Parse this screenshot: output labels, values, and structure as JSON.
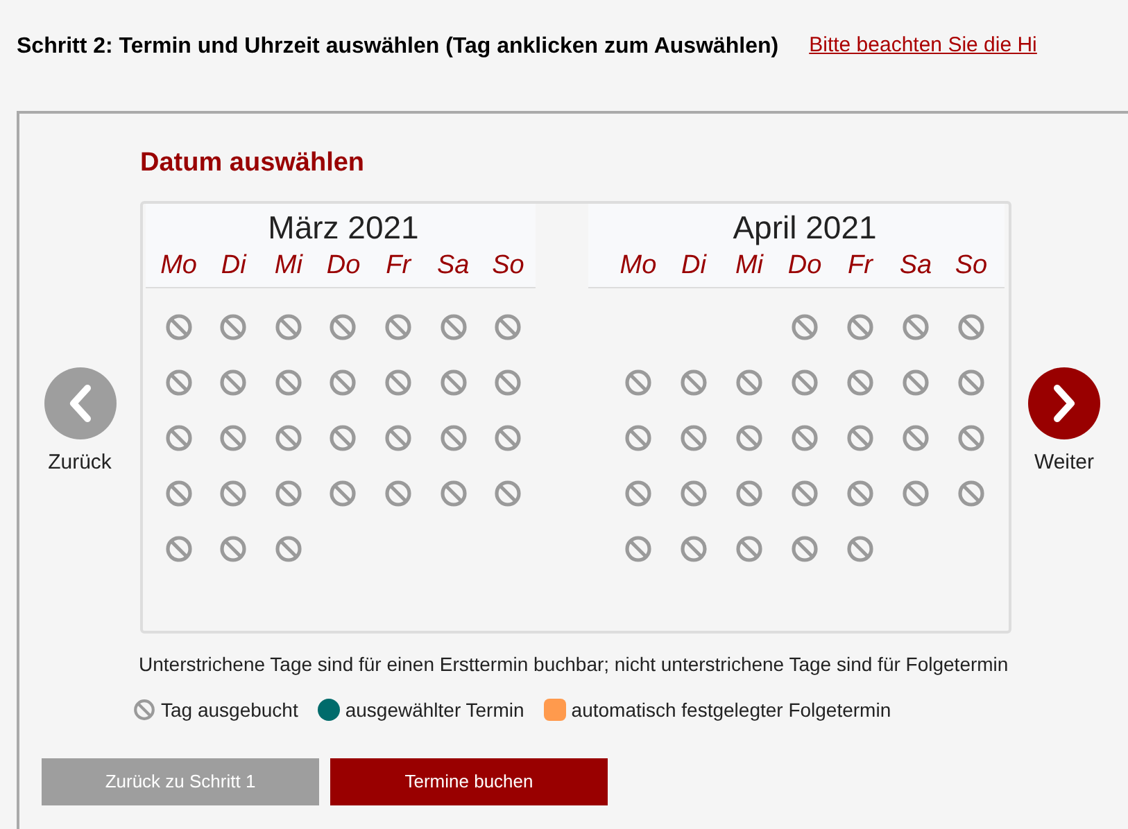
{
  "heading": "Schritt 2: Termin und Uhrzeit auswählen (Tag anklicken zum Auswählen)",
  "notice_link": "Bitte beachten Sie die Hi",
  "section_title": "Datum auswählen",
  "prev": {
    "label": "Zurück",
    "enabled": false
  },
  "next": {
    "label": "Weiter",
    "enabled": true
  },
  "months": [
    {
      "title": "März 2021",
      "weekdays": [
        "Mo",
        "Di",
        "Mi",
        "Do",
        "Fr",
        "Sa",
        "So"
      ],
      "days": [
        {
          "kind": "day",
          "booked": true
        },
        {
          "kind": "day",
          "booked": true
        },
        {
          "kind": "day",
          "booked": true
        },
        {
          "kind": "day",
          "booked": true
        },
        {
          "kind": "day",
          "booked": true
        },
        {
          "kind": "day",
          "booked": true
        },
        {
          "kind": "day",
          "booked": true
        },
        {
          "kind": "day",
          "booked": true
        },
        {
          "kind": "day",
          "booked": true
        },
        {
          "kind": "day",
          "booked": true
        },
        {
          "kind": "day",
          "booked": true
        },
        {
          "kind": "day",
          "booked": true
        },
        {
          "kind": "day",
          "booked": true
        },
        {
          "kind": "day",
          "booked": true
        },
        {
          "kind": "day",
          "booked": true
        },
        {
          "kind": "day",
          "booked": true
        },
        {
          "kind": "day",
          "booked": true
        },
        {
          "kind": "day",
          "booked": true
        },
        {
          "kind": "day",
          "booked": true
        },
        {
          "kind": "day",
          "booked": true
        },
        {
          "kind": "day",
          "booked": true
        },
        {
          "kind": "day",
          "booked": true
        },
        {
          "kind": "day",
          "booked": true
        },
        {
          "kind": "day",
          "booked": true
        },
        {
          "kind": "day",
          "booked": true
        },
        {
          "kind": "day",
          "booked": true
        },
        {
          "kind": "day",
          "booked": true
        },
        {
          "kind": "day",
          "booked": true
        },
        {
          "kind": "day",
          "booked": true
        },
        {
          "kind": "day",
          "booked": true
        },
        {
          "kind": "day",
          "booked": true
        }
      ]
    },
    {
      "title": "April 2021",
      "weekdays": [
        "Mo",
        "Di",
        "Mi",
        "Do",
        "Fr",
        "Sa",
        "So"
      ],
      "days": [
        {
          "kind": "blank"
        },
        {
          "kind": "blank"
        },
        {
          "kind": "blank"
        },
        {
          "kind": "day",
          "booked": true
        },
        {
          "kind": "day",
          "booked": true
        },
        {
          "kind": "day",
          "booked": true
        },
        {
          "kind": "day",
          "booked": true
        },
        {
          "kind": "day",
          "booked": true
        },
        {
          "kind": "day",
          "booked": true
        },
        {
          "kind": "day",
          "booked": true
        },
        {
          "kind": "day",
          "booked": true
        },
        {
          "kind": "day",
          "booked": true
        },
        {
          "kind": "day",
          "booked": true
        },
        {
          "kind": "day",
          "booked": true
        },
        {
          "kind": "day",
          "booked": true
        },
        {
          "kind": "day",
          "booked": true
        },
        {
          "kind": "day",
          "booked": true
        },
        {
          "kind": "day",
          "booked": true
        },
        {
          "kind": "day",
          "booked": true
        },
        {
          "kind": "day",
          "booked": true
        },
        {
          "kind": "day",
          "booked": true
        },
        {
          "kind": "day",
          "booked": true
        },
        {
          "kind": "day",
          "booked": true
        },
        {
          "kind": "day",
          "booked": true
        },
        {
          "kind": "day",
          "booked": true
        },
        {
          "kind": "day",
          "booked": true
        },
        {
          "kind": "day",
          "booked": true
        },
        {
          "kind": "day",
          "booked": true
        },
        {
          "kind": "day",
          "booked": true
        },
        {
          "kind": "day",
          "booked": true
        },
        {
          "kind": "day",
          "booked": true
        },
        {
          "kind": "day",
          "booked": true
        },
        {
          "kind": "day",
          "booked": true
        }
      ]
    }
  ],
  "note": "Unterstrichene Tage sind für einen Ersttermin buchbar; nicht unterstrichene Tage sind für Folgetermin",
  "legend": [
    {
      "kind": "booked",
      "label": "Tag ausgebucht"
    },
    {
      "kind": "dot",
      "color": "#006b6b",
      "label": "ausgewählter Termin"
    },
    {
      "kind": "square",
      "color": "#ff9a4d",
      "label": "automatisch festgelegter Folgetermin"
    }
  ],
  "buttons": [
    {
      "label": "Zurück zu Schritt 1",
      "kind": "secondary"
    },
    {
      "label": "Termine buchen",
      "kind": "primary"
    }
  ]
}
